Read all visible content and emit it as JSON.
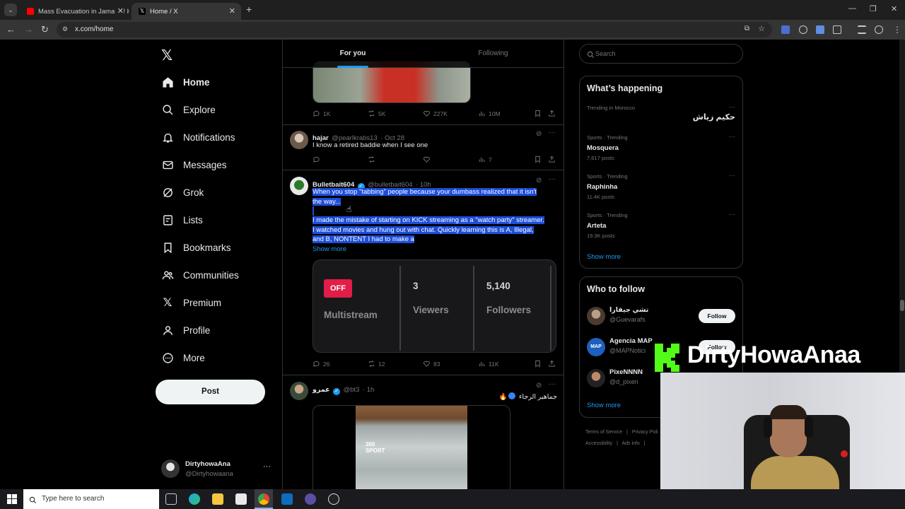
{
  "browser": {
    "tabs": [
      {
        "title": "Mass Evacuation in Jamaica! Hi",
        "active": false
      },
      {
        "title": "Home / X",
        "active": true
      }
    ],
    "url": "x.com/home"
  },
  "sidebar": {
    "items": [
      {
        "label": "Home",
        "icon": "home-icon"
      },
      {
        "label": "Explore",
        "icon": "search-icon"
      },
      {
        "label": "Notifications",
        "icon": "bell-icon"
      },
      {
        "label": "Messages",
        "icon": "mail-icon"
      },
      {
        "label": "Grok",
        "icon": "grok-icon"
      },
      {
        "label": "Lists",
        "icon": "list-icon"
      },
      {
        "label": "Bookmarks",
        "icon": "bookmark-icon"
      },
      {
        "label": "Communities",
        "icon": "people-icon"
      },
      {
        "label": "Premium",
        "icon": "x-logo-icon"
      },
      {
        "label": "Profile",
        "icon": "person-icon"
      },
      {
        "label": "More",
        "icon": "more-circle-icon"
      }
    ],
    "post_label": "Post",
    "account": {
      "name": "DirtyhowaAna",
      "handle": "@Dirtyhowaana"
    }
  },
  "timeline": {
    "tabs": [
      "For you",
      "Following"
    ],
    "tweet0": {
      "replies": "1K",
      "reposts": "5K",
      "likes": "227K",
      "views": "10M"
    },
    "tweet1": {
      "name": "hajar",
      "handle": "@pearlkrabs13",
      "time": "· Oct 28",
      "text": "I know a retired baddie when I see one",
      "replies": "",
      "reposts": "",
      "likes": "",
      "views": "7"
    },
    "tweet2": {
      "name": "Bulletbait604",
      "handle": "@bulletbait604",
      "time": "· 10h",
      "line1": "When you stop \"tabbing\" people because your dumbass realized that it isn't",
      "line2": "the way...",
      "line3": "I made the mistake of starting on KICK streaming as a \"watch party\" streamer.",
      "line4": "I watched movies and hung out with chat. Quickly learning this is A, Illegal,",
      "line5": "and B, NONTENT I had to make a",
      "show_more": "Show more",
      "card": {
        "badge": "OFF",
        "badge_label": "Multistream",
        "viewers_value": "3",
        "viewers_label": "Viewers",
        "followers_value": "5,140",
        "followers_label": "Followers"
      },
      "replies": "26",
      "reposts": "12",
      "likes": "83",
      "views": "11K"
    },
    "tweet3": {
      "name": "عمرو",
      "handle": "@bt3",
      "time": "· 1h",
      "text": "جماهير الرجاء"
    }
  },
  "right": {
    "search_placeholder": "Search",
    "happening_title": "What’s happening",
    "trends": [
      {
        "meta": "Trending in Morocco",
        "title": "حكيم زياش",
        "posts": ""
      },
      {
        "meta": "Sports · Trending",
        "title": "Mosquera",
        "posts": "7,617 posts"
      },
      {
        "meta": "Sports · Trending",
        "title": "Raphinha",
        "posts": "11.4K posts"
      },
      {
        "meta": "Sports · Trending",
        "title": "Arteta",
        "posts": "19.3K posts"
      }
    ],
    "show_more": "Show more",
    "who_title": "Who to follow",
    "follow": [
      {
        "name": "تشي جيفارا",
        "handle": "@Guevarafs",
        "button": "Follow"
      },
      {
        "name": "Agencia MAP",
        "handle": "@MAPNotici",
        "button": "Follow"
      },
      {
        "name": "PixeNNNN",
        "handle": "@d_pixen",
        "button": ""
      }
    ],
    "who_show_more": "Show more",
    "footer": [
      "Terms of Service",
      "Privacy Poli",
      "Accessibility",
      "Ads info"
    ]
  },
  "overlay": {
    "streamer_name": "DirtyHowaAnaa"
  },
  "taskbar": {
    "search_placeholder": "Type here to search"
  },
  "colors": {
    "accent": "#1d9bf0",
    "kick_green": "#53fc18",
    "badge_red": "#e11d48"
  }
}
